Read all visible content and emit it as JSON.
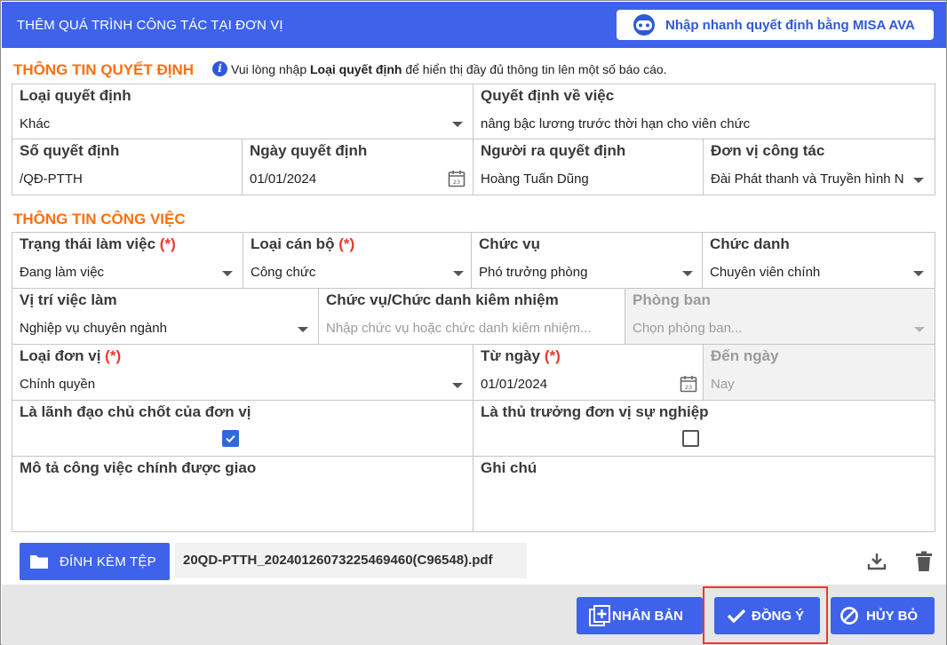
{
  "dialog": {
    "title": "THÊM QUÁ TRÌNH CÔNG TÁC TẠI ĐƠN VỊ",
    "ava_button": "Nhập nhanh quyết định bằng MISA AVA"
  },
  "decision": {
    "section_title": "THÔNG TIN QUYẾT ĐỊNH",
    "note_prefix": "Vui lòng nhập",
    "note_bold": "Loại quyết định",
    "note_suffix": "để hiển thị đầy đủ thông tin lên một số báo cáo.",
    "type": {
      "label": "Loại quyết định",
      "value": "Khác"
    },
    "subject": {
      "label": "Quyết định về việc",
      "value": "nâng bậc lương trước thời hạn cho viên chức"
    },
    "number": {
      "label": "Số quyết định",
      "value": "/QĐ-PTTH"
    },
    "date": {
      "label": "Ngày quyết định",
      "value": "01/01/2024"
    },
    "signer": {
      "label": "Người ra quyết định",
      "value": "Hoàng Tuấn Dũng"
    },
    "unit": {
      "label": "Đơn vị công tác",
      "value": "Đài Phát thanh và Truyền hình N"
    }
  },
  "work": {
    "section_title": "THÔNG TIN CÔNG VIỆC",
    "status": {
      "label": "Trạng thái làm việc",
      "required": "(*)",
      "value": "Đang làm việc"
    },
    "staff_type": {
      "label": "Loại cán bộ",
      "required": "(*)",
      "value": "Công chức"
    },
    "position": {
      "label": "Chức vụ",
      "value": "Phó trưởng phòng"
    },
    "title": {
      "label": "Chức danh",
      "value": "Chuyên viên chính"
    },
    "job_position": {
      "label": "Vị trí việc làm",
      "value": "Nghiệp vụ chuyên ngành"
    },
    "concurrent": {
      "label": "Chức vụ/Chức danh kiêm nhiệm",
      "placeholder": "Nhập chức vụ hoặc chức danh kiêm nhiệm..."
    },
    "department": {
      "label": "Phòng ban",
      "placeholder": "Chọn phòng ban..."
    },
    "unit_type": {
      "label": "Loại đơn vị",
      "required": "(*)",
      "value": "Chính quyền"
    },
    "from_date": {
      "label": "Từ ngày",
      "required": "(*)",
      "value": "01/01/2024"
    },
    "to_date": {
      "label": "Đến ngày",
      "placeholder": "Nay"
    },
    "key_leader": {
      "label": "Là lãnh đạo chủ chốt của đơn vị",
      "checked": true
    },
    "head_of_unit": {
      "label": "Là thủ trưởng đơn vị sự nghiệp",
      "checked": false
    },
    "description": {
      "label": "Mô tả công việc chính được giao",
      "value": ""
    },
    "note": {
      "label": "Ghi chú",
      "value": ""
    }
  },
  "attachment": {
    "button": "ĐÍNH KÈM TỆP",
    "file_name": "20QD-PTTH_20240126073225469460(C96548).pdf"
  },
  "footer": {
    "duplicate": "NHÂN BẢN",
    "ok": "ĐỒNG Ý",
    "cancel": "HỦY BỎ"
  },
  "colors": {
    "primary": "#3e63ea",
    "section_title": "#ff6f0f",
    "required": "#e8392c",
    "highlight": "#e8392c"
  }
}
